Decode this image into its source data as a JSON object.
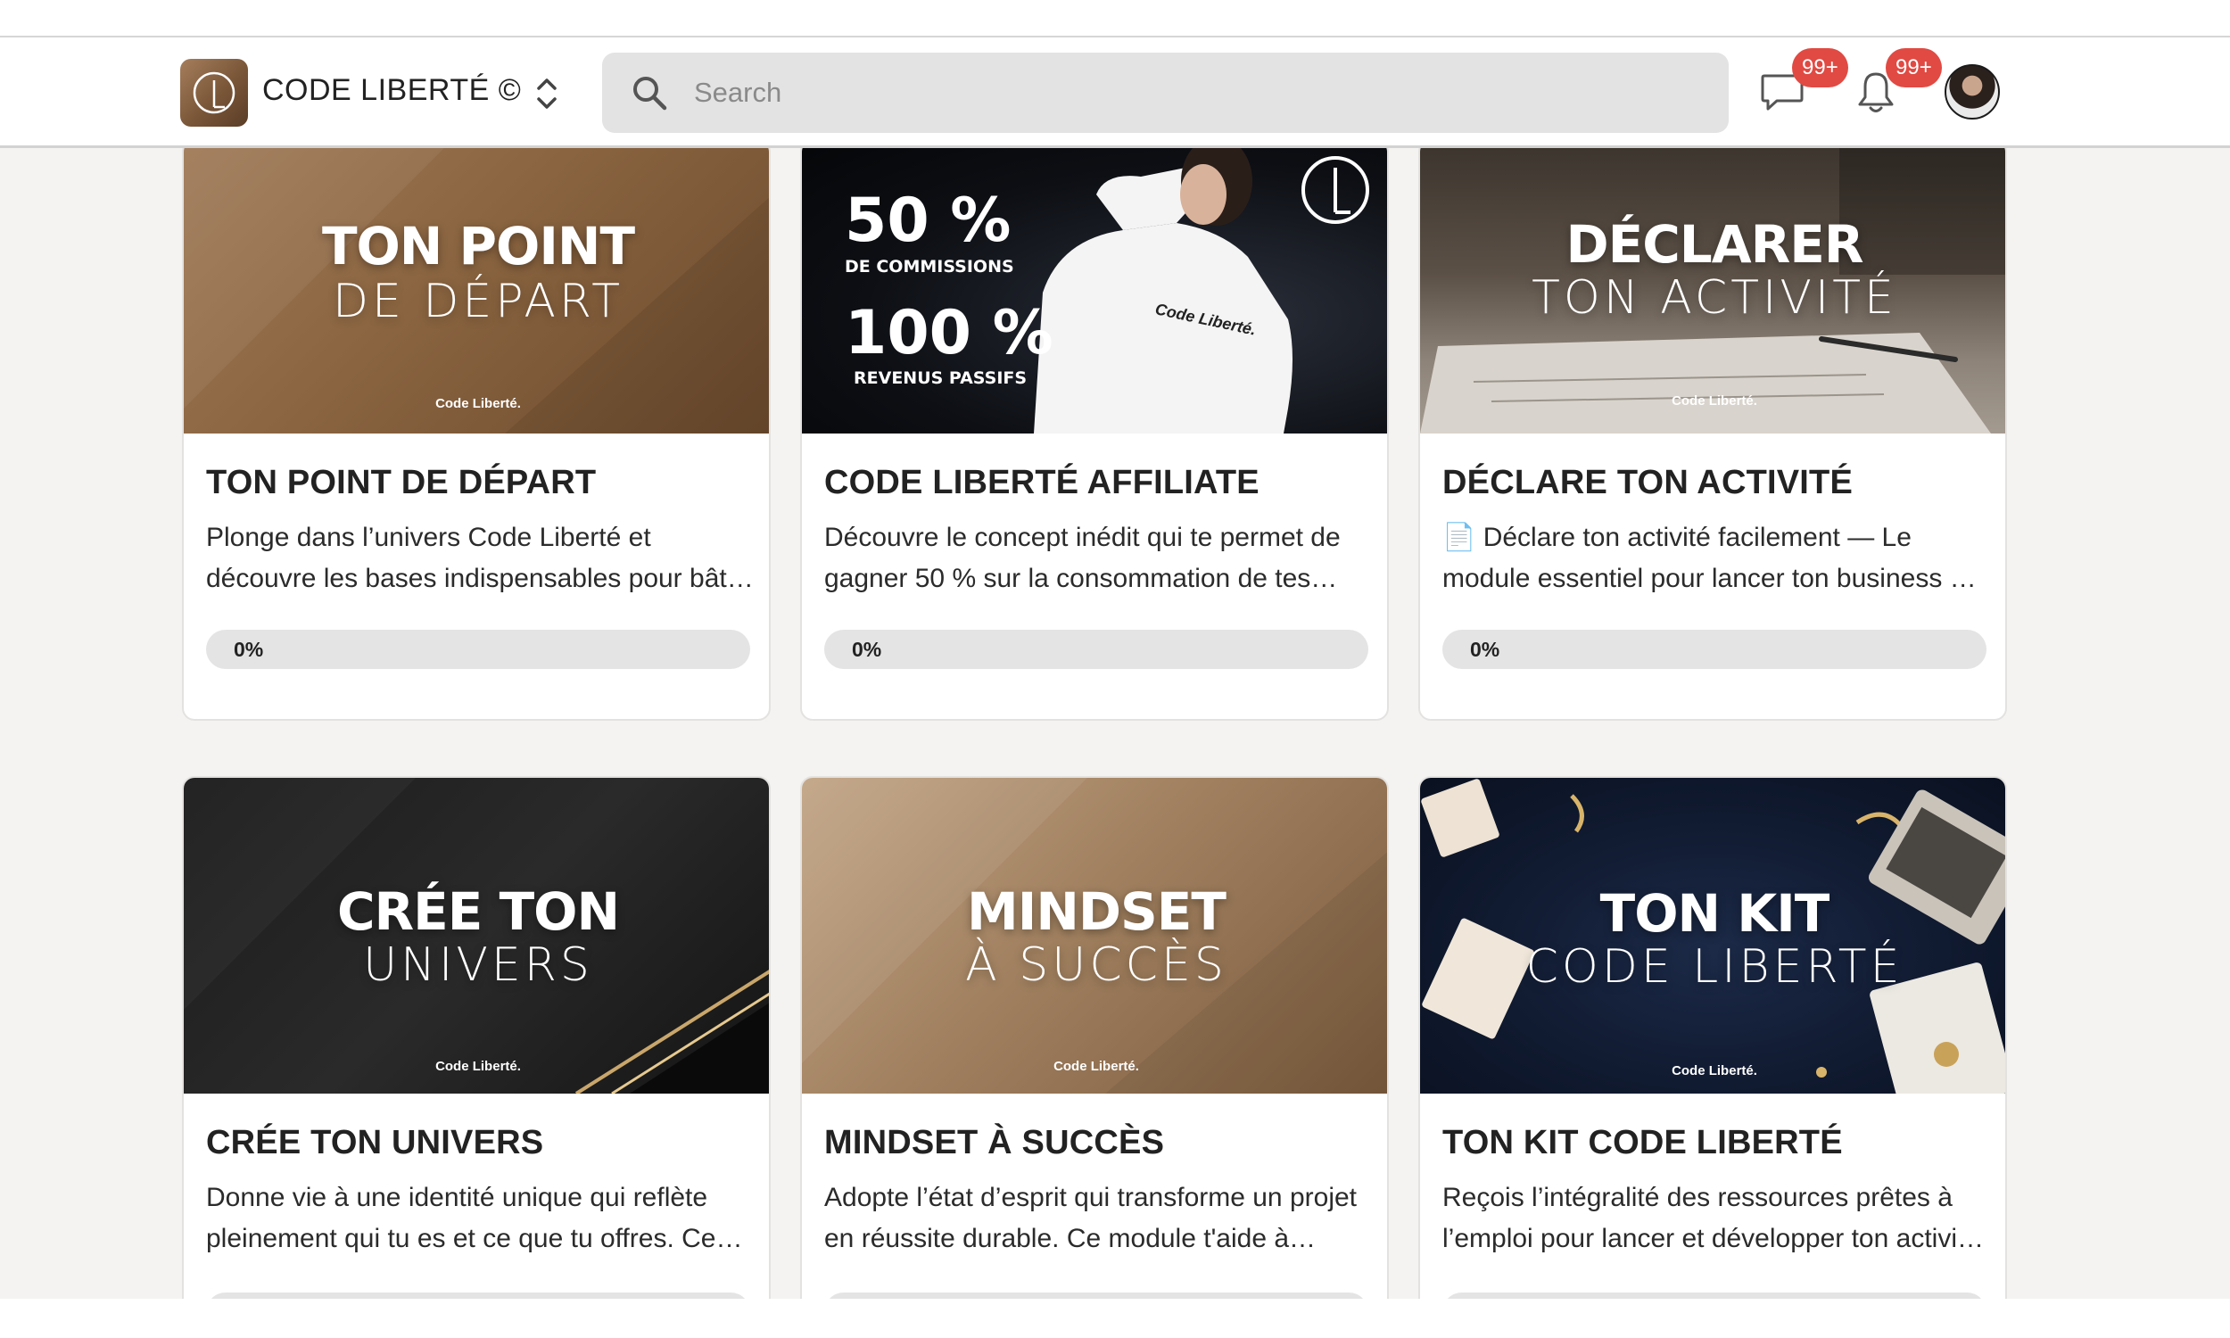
{
  "header": {
    "brand": "CODE LIBERTÉ ©",
    "search_placeholder": "Search",
    "messages_badge": "99+",
    "notifications_badge": "99+"
  },
  "colors": {
    "accent": "#a57e5c",
    "badge": "#e04a43",
    "progress_track": "#e4e4e4"
  },
  "courses": [
    {
      "thumb_line1": "TON POINT",
      "thumb_line2": "DE DÉPART",
      "thumb_watermark": "Code Liberté.",
      "title": "TON POINT DE DÉPART",
      "desc_line1": "Plonge dans l’univers Code Liberté et",
      "desc_line2": "découvre les bases indispensables pour bât…",
      "progress": 0,
      "progress_label": "0%"
    },
    {
      "thumb_big1": "50 %",
      "thumb_small1": "DE COMMISSIONS",
      "thumb_big2": "100 %",
      "thumb_small2": "REVENUS PASSIFS",
      "thumb_shirt": "Code Liberté.",
      "title": "CODE LIBERTÉ AFFILIATE",
      "desc_line1": "Découvre le concept inédit qui te permet de",
      "desc_line2": "gagner 50 % sur la consommation de tes…",
      "progress": 0,
      "progress_label": "0%"
    },
    {
      "thumb_line1": "DÉCLARER",
      "thumb_line2": "TON ACTIVITÉ",
      "thumb_watermark": "Code Liberté.",
      "title": "DÉCLARE TON ACTIVITÉ",
      "desc_line1": "📄 Déclare ton activité facilement — Le",
      "desc_line2": "module essentiel pour lancer ton business …",
      "progress": 0,
      "progress_label": "0%"
    },
    {
      "thumb_line1": "CRÉE TON",
      "thumb_line2": "UNIVERS",
      "thumb_watermark": "Code Liberté.",
      "title": "CRÉE TON UNIVERS",
      "desc_line1": "Donne vie à une identité unique qui reflète",
      "desc_line2": "pleinement qui tu es et ce que tu offres. Ce…"
    },
    {
      "thumb_line1": "MINDSET",
      "thumb_line2": "À SUCCÈS",
      "thumb_watermark": "Code Liberté.",
      "title": "MINDSET À SUCCÈS",
      "desc_line1": "Adopte l’état d’esprit qui transforme un projet",
      "desc_line2": "en réussite durable. Ce module t'aide à…"
    },
    {
      "thumb_line1": "TON KIT",
      "thumb_line2": "CODE LIBERTÉ",
      "thumb_watermark": "Code Liberté.",
      "title": "TON KIT CODE LIBERTÉ",
      "desc_line1": "Reçois l’intégralité des ressources prêtes à",
      "desc_line2": "l’emploi pour lancer et développer ton activi…"
    }
  ]
}
